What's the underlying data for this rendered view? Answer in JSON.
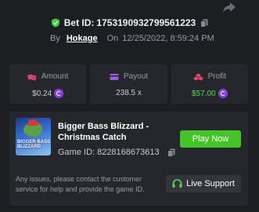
{
  "header": {
    "bet_label": "Bet ID:",
    "bet_id": "1753190932799561223",
    "by_label": "By",
    "username": "Hokage",
    "on_label": "On",
    "timestamp": "12/25/2022, 8:59:24 PM"
  },
  "stats": {
    "amount": {
      "label": "Amount",
      "value": "$0.24",
      "icon": "dice-icon"
    },
    "payout": {
      "label": "Payout",
      "value": "238.5 x",
      "icon": "card-icon"
    },
    "profit": {
      "label": "Profit",
      "value": "$57.00",
      "icon": "coins-icon"
    }
  },
  "game": {
    "title": "Bigger Bass Blizzard - Christmas Catch",
    "thumb_title": "BIGGER BASS BLIZZARD",
    "id_label": "Game ID:",
    "id": "8228168673613",
    "play_label": "Play Now"
  },
  "support": {
    "help_text": "Any issues, please contact the customer service for help and provide the game ID.",
    "button_label": "Live Support"
  },
  "colors": {
    "background": "#1d1e22",
    "card": "#26272c",
    "play_green": "#45c32b",
    "profit_green": "#4ee04e",
    "coin_purple": "#8a3fe0",
    "amount_icon": "#e0436b",
    "payout_icon": "#9b5ce8",
    "profit_icon": "#e0436b"
  }
}
